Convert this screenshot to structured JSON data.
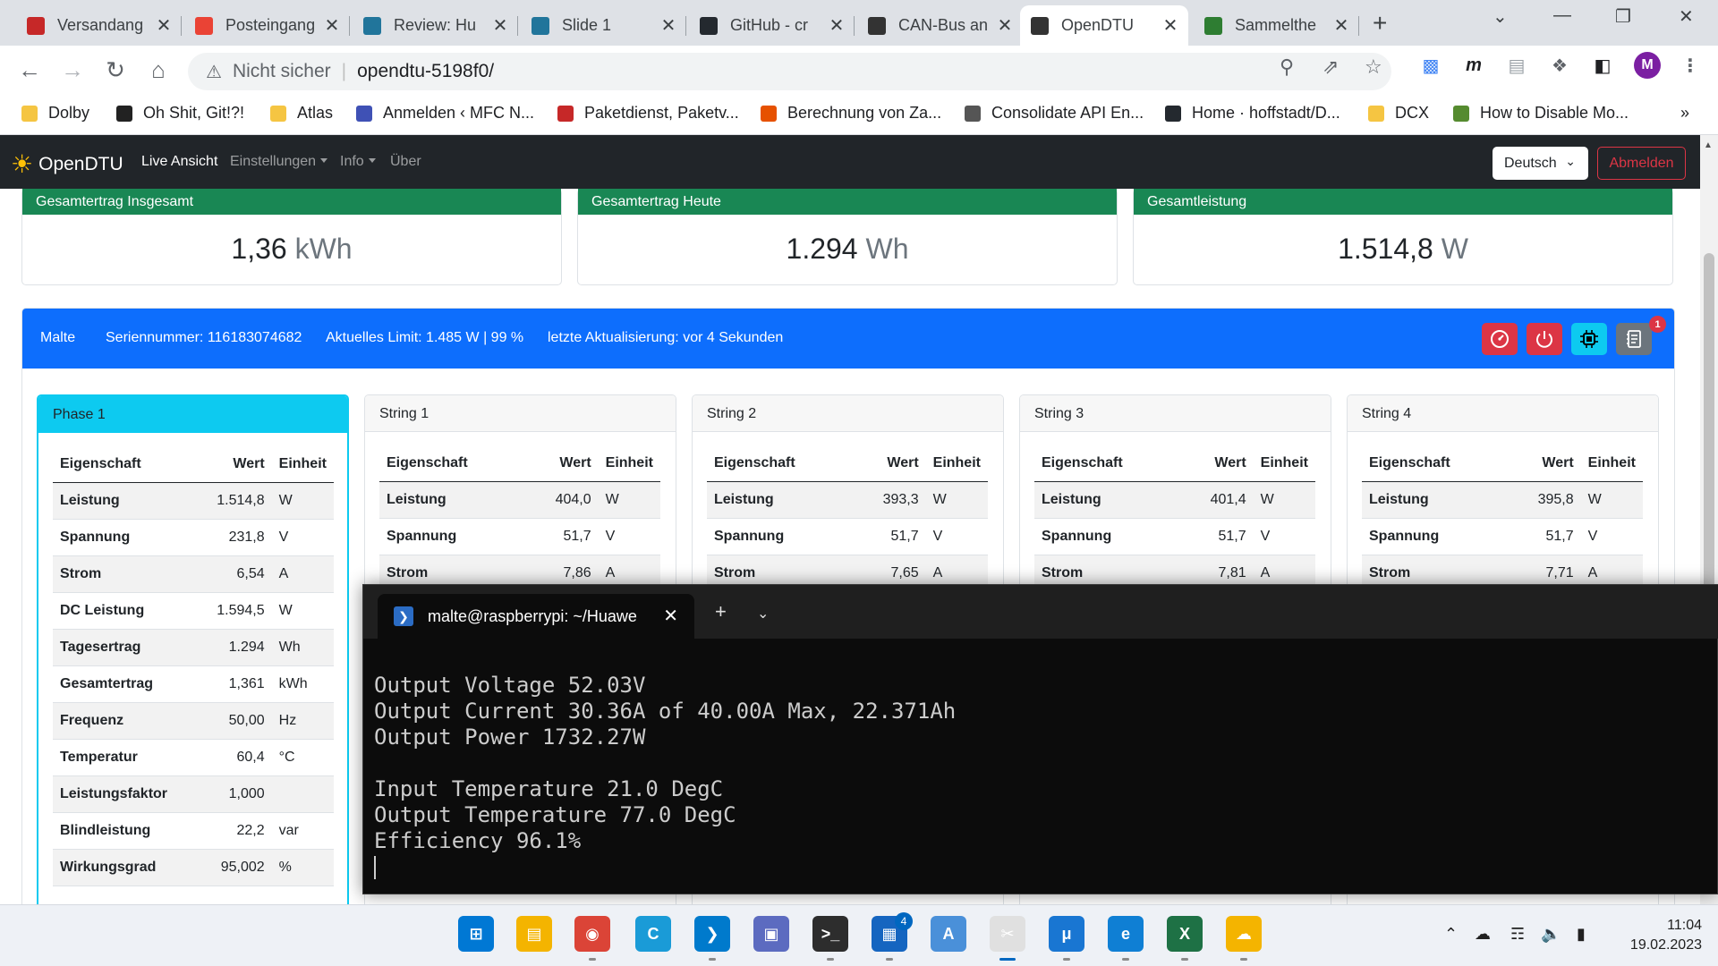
{
  "browser": {
    "tabs": [
      {
        "label": "Versandang",
        "icon": "shipping-icon",
        "color": "#c62828"
      },
      {
        "label": "Posteingang",
        "icon": "gmail-icon",
        "color": "#ea4335"
      },
      {
        "label": "Review: Hu",
        "icon": "wordpress-icon",
        "color": "#21759b"
      },
      {
        "label": "Slide 1",
        "icon": "wordpress-icon",
        "color": "#21759b"
      },
      {
        "label": "GitHub - cr",
        "icon": "github-icon",
        "color": "#24292f"
      },
      {
        "label": "CAN-Bus an",
        "icon": "chip-icon",
        "color": "#333333"
      },
      {
        "label": "OpenDTU",
        "icon": "sun-icon",
        "color": "#333333"
      },
      {
        "label": "Sammelthe",
        "icon": "check-icon",
        "color": "#2e7d32"
      }
    ],
    "address": {
      "security_label": "Nicht sicher",
      "url": "opendtu-5198f0/"
    },
    "profile_initial": "M",
    "bookmarks": [
      {
        "label": "Dolby",
        "icon": "folder-icon",
        "color": "#f5c542"
      },
      {
        "label": "Oh Shit, Git!?!",
        "icon": "exclamation-icon",
        "color": "#222222"
      },
      {
        "label": "Atlas",
        "icon": "folder-icon",
        "color": "#f5c542"
      },
      {
        "label": "Anmelden ‹ MFC N...",
        "icon": "globe-icon",
        "color": "#3f51b5"
      },
      {
        "label": "Paketdienst, Paketv...",
        "icon": "parcel-icon",
        "color": "#c62828"
      },
      {
        "label": "Berechnung von Za...",
        "icon": "calc-icon",
        "color": "#e65100"
      },
      {
        "label": "Consolidate API En...",
        "icon": "doc-icon",
        "color": "#555555"
      },
      {
        "label": "Home · hoffstadt/D...",
        "icon": "github-icon",
        "color": "#24292f"
      },
      {
        "label": "DCX",
        "icon": "folder-icon",
        "color": "#f5c542"
      },
      {
        "label": "How to Disable Mo...",
        "icon": "leaf-icon",
        "color": "#558b2f"
      }
    ]
  },
  "app": {
    "brand": "OpenDTU",
    "nav": {
      "live": "Live Ansicht",
      "settings": "Einstellungen",
      "info": "Info",
      "about": "Über"
    },
    "language": "Deutsch",
    "logout": "Abmelden"
  },
  "summary": [
    {
      "title": "Gesamtertrag Insgesamt",
      "value": "1,36",
      "unit": "kWh"
    },
    {
      "title": "Gesamtertrag Heute",
      "value": "1.294",
      "unit": "Wh"
    },
    {
      "title": "Gesamtleistung",
      "value": "1.514,8",
      "unit": "W"
    }
  ],
  "inverter": {
    "name": "Malte",
    "serial": "Seriennummer: 116183074682",
    "limit": "Aktuelles Limit: 1.485 W | 99 %",
    "updated": "letzte Aktualisierung: vor 4 Sekunden",
    "event_count": "1",
    "actions": [
      {
        "icon": "speedometer-icon",
        "color": "#dc3545"
      },
      {
        "icon": "power-icon",
        "color": "#dc3545"
      },
      {
        "icon": "cpu-icon",
        "color": "#0dcaf0"
      },
      {
        "icon": "journal-icon",
        "color": "#6c757d"
      }
    ]
  },
  "table_headers": {
    "prop": "Eigenschaft",
    "value": "Wert",
    "unit": "Einheit"
  },
  "channels": [
    {
      "title": "Phase 1",
      "rows": [
        {
          "k": "Leistung",
          "v": "1.514,8",
          "u": "W"
        },
        {
          "k": "Spannung",
          "v": "231,8",
          "u": "V"
        },
        {
          "k": "Strom",
          "v": "6,54",
          "u": "A"
        },
        {
          "k": "DC Leistung",
          "v": "1.594,5",
          "u": "W"
        },
        {
          "k": "Tagesertrag",
          "v": "1.294",
          "u": "Wh"
        },
        {
          "k": "Gesamtertrag",
          "v": "1,361",
          "u": "kWh"
        },
        {
          "k": "Frequenz",
          "v": "50,00",
          "u": "Hz"
        },
        {
          "k": "Temperatur",
          "v": "60,4",
          "u": "°C"
        },
        {
          "k": "Leistungsfaktor",
          "v": "1,000",
          "u": ""
        },
        {
          "k": "Blindleistung",
          "v": "22,2",
          "u": "var"
        },
        {
          "k": "Wirkungsgrad",
          "v": "95,002",
          "u": "%"
        }
      ]
    },
    {
      "title": "String 1",
      "rows": [
        {
          "k": "Leistung",
          "v": "404,0",
          "u": "W"
        },
        {
          "k": "Spannung",
          "v": "51,7",
          "u": "V"
        },
        {
          "k": "Strom",
          "v": "7,86",
          "u": "A"
        }
      ]
    },
    {
      "title": "String 2",
      "rows": [
        {
          "k": "Leistung",
          "v": "393,3",
          "u": "W"
        },
        {
          "k": "Spannung",
          "v": "51,7",
          "u": "V"
        },
        {
          "k": "Strom",
          "v": "7,65",
          "u": "A"
        }
      ]
    },
    {
      "title": "String 3",
      "rows": [
        {
          "k": "Leistung",
          "v": "401,4",
          "u": "W"
        },
        {
          "k": "Spannung",
          "v": "51,7",
          "u": "V"
        },
        {
          "k": "Strom",
          "v": "7,81",
          "u": "A"
        }
      ]
    },
    {
      "title": "String 4",
      "rows": [
        {
          "k": "Leistung",
          "v": "395,8",
          "u": "W"
        },
        {
          "k": "Spannung",
          "v": "51,7",
          "u": "V"
        },
        {
          "k": "Strom",
          "v": "7,71",
          "u": "A"
        }
      ]
    }
  ],
  "terminal": {
    "tab_title": "malte@raspberrypi: ~/Huawe",
    "lines": [
      "Output Voltage 52.03V",
      "Output Current 30.36A of 40.00A Max, 22.371Ah",
      "Output Power 1732.27W",
      "",
      "Input Temperature 21.0 DegC",
      "Output Temperature 77.0 DegC",
      "Efficiency 96.1%"
    ]
  },
  "taskbar": {
    "apps": [
      {
        "name": "windows-start-icon",
        "color": "#0078d4",
        "glyph": "⊞"
      },
      {
        "name": "file-explorer-icon",
        "color": "#f4b400",
        "glyph": "▤"
      },
      {
        "name": "chrome-icon",
        "color": "#db4437",
        "glyph": "◉"
      },
      {
        "name": "c-app-icon",
        "color": "#1a9bd7",
        "glyph": "C"
      },
      {
        "name": "vscode-icon",
        "color": "#007acc",
        "glyph": "❯"
      },
      {
        "name": "remote-desktop-icon",
        "color": "#5c6bc0",
        "glyph": "▣"
      },
      {
        "name": "terminal-icon",
        "color": "#2d2d2d",
        "glyph": ">_"
      },
      {
        "name": "store-icon",
        "color": "#1565c0",
        "glyph": "▦"
      },
      {
        "name": "arduino-a-icon",
        "color": "#4a90d9",
        "glyph": "A"
      },
      {
        "name": "snipping-icon",
        "color": "#e0e0e0",
        "glyph": "✂"
      },
      {
        "name": "mu-editor-icon",
        "color": "#1976d2",
        "glyph": "μ"
      },
      {
        "name": "edge-icon",
        "color": "#0f7fd4",
        "glyph": "e"
      },
      {
        "name": "excel-icon",
        "color": "#1e7145",
        "glyph": "X"
      },
      {
        "name": "onedrive-folder-icon",
        "color": "#f4b400",
        "glyph": "☁"
      }
    ],
    "store_badge": "4",
    "time": "11:04",
    "date": "19.02.2023"
  }
}
